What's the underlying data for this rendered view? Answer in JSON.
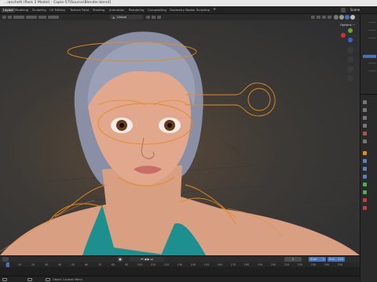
{
  "window": {
    "title": "...ianchett (Pack 2 Model) - Copie-57\\Source\\Blender.blend]"
  },
  "workspaces": {
    "tabs": [
      "Layout",
      "Modeling",
      "Sculpting",
      "UV Editing",
      "Texture Paint",
      "Shading",
      "Animation",
      "Rendering",
      "Compositing",
      "Geometry Nodes",
      "Scripting"
    ],
    "active": "Layout",
    "add_label": "+",
    "scene_label": "Scene"
  },
  "viewport": {
    "orientation_value": "Global",
    "options_label": "Options ~"
  },
  "timeline": {
    "start_label": "Start",
    "start_value": "1",
    "end_label": "End",
    "end_value": "250",
    "current_frame": "1",
    "ticks": [
      "0",
      "10",
      "20",
      "30",
      "40",
      "50",
      "60",
      "70",
      "80",
      "90",
      "100",
      "110",
      "120",
      "130",
      "140",
      "150",
      "160",
      "170",
      "180",
      "190",
      "200",
      "210",
      "220",
      "230",
      "240",
      "250"
    ]
  },
  "statusbar": {
    "hint": "Object Context Menu"
  },
  "colors": {
    "accent": "#4772b3",
    "rig_orange": "#e88a1a",
    "active_tab_bg": "#3d3d3d"
  }
}
